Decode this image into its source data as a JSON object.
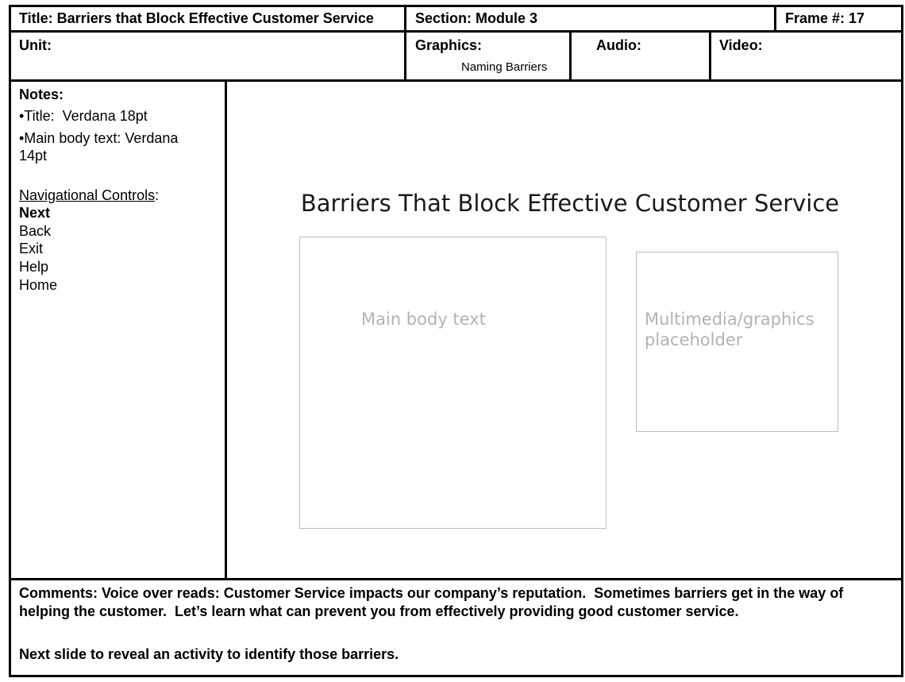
{
  "header": {
    "title": "Title: Barriers that Block Effective Customer Service",
    "section": "Section: Module 3",
    "frame": "Frame #: 17"
  },
  "row2": {
    "unit": "Unit:",
    "graphics_label": "Graphics:",
    "graphics_value": "Naming Barriers",
    "audio_label": "Audio:",
    "video_label": "Video:"
  },
  "notes": {
    "heading": "Notes:",
    "title_font": "•Title:  Verdana 18pt",
    "body_font_line1": "•Main body text: Verdana",
    "body_font_line2": "14pt",
    "nav_heading": "Navigational Controls",
    "nav_colon": ":",
    "nav_items": [
      "Next",
      "Back",
      "Exit",
      "Help",
      "Home"
    ]
  },
  "slide": {
    "title": "Barriers That Block Effective Customer Service",
    "main_body_placeholder": "Main body text",
    "media_placeholder_line1": "Multimedia/graphics",
    "media_placeholder_line2": "placeholder"
  },
  "comments": {
    "line1": "Comments: Voice over reads: Customer Service impacts our company’s reputation.  Sometimes barriers get in the way of helping the customer.  Let’s learn what can prevent you from effectively providing good customer service.",
    "line2": "Next slide to reveal an activity to identify those barriers."
  },
  "colors": {
    "border": "#000000",
    "placeholder_text": "#b3b3b3",
    "placeholder_border": "#bdbdbd"
  }
}
